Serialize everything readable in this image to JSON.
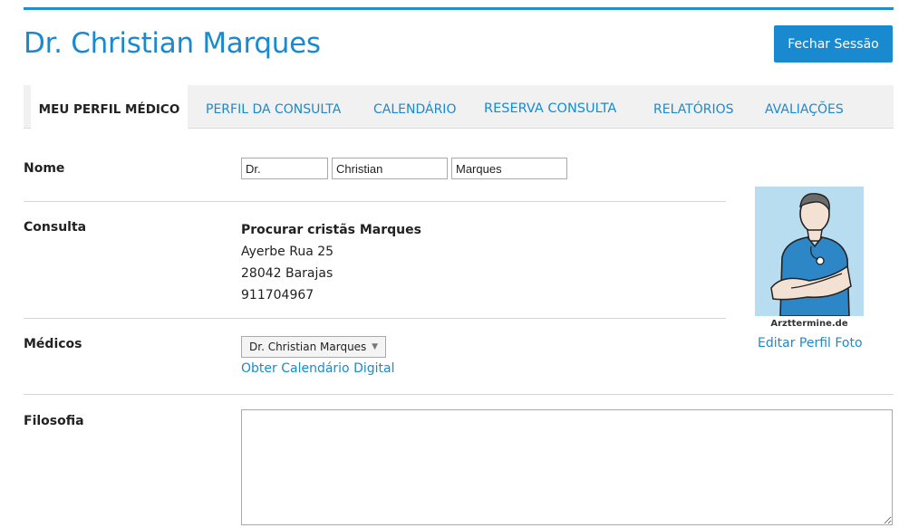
{
  "header": {
    "title": "Dr. Christian Marques",
    "logout_label": "Fechar Sessão"
  },
  "tabs": [
    {
      "label": "MEU PERFIL MÉDICO",
      "active": true
    },
    {
      "label": "PERFIL DA CONSULTA",
      "active": false
    },
    {
      "label": "CALENDÁRIO",
      "active": false
    },
    {
      "label": "RESERVA CONSULTA",
      "active": false
    },
    {
      "label": "RELATÓRIOS",
      "active": false
    },
    {
      "label": "AVALIAÇÕES",
      "active": false
    }
  ],
  "form": {
    "nome": {
      "label": "Nome",
      "title_value": "Dr.",
      "first_name_value": "Christian",
      "last_name_value": "Marques"
    },
    "consulta": {
      "label": "Consulta",
      "name": "Procurar cristãs Marques",
      "street": "Ayerbe Rua 25",
      "city": "28042 Barajas",
      "phone": "911704967"
    },
    "medicos": {
      "label": "Médicos",
      "selected": "Dr. Christian Marques",
      "calendar_link": "Obter Calendário Digital"
    },
    "filosofia": {
      "label": "Filosofia",
      "value": ""
    }
  },
  "photo": {
    "brand_text": "Arzttermine.de",
    "edit_link": "Editar Perfil Foto"
  },
  "colors": {
    "accent": "#1a8ad0",
    "photo_background": "#b8dcf0"
  }
}
